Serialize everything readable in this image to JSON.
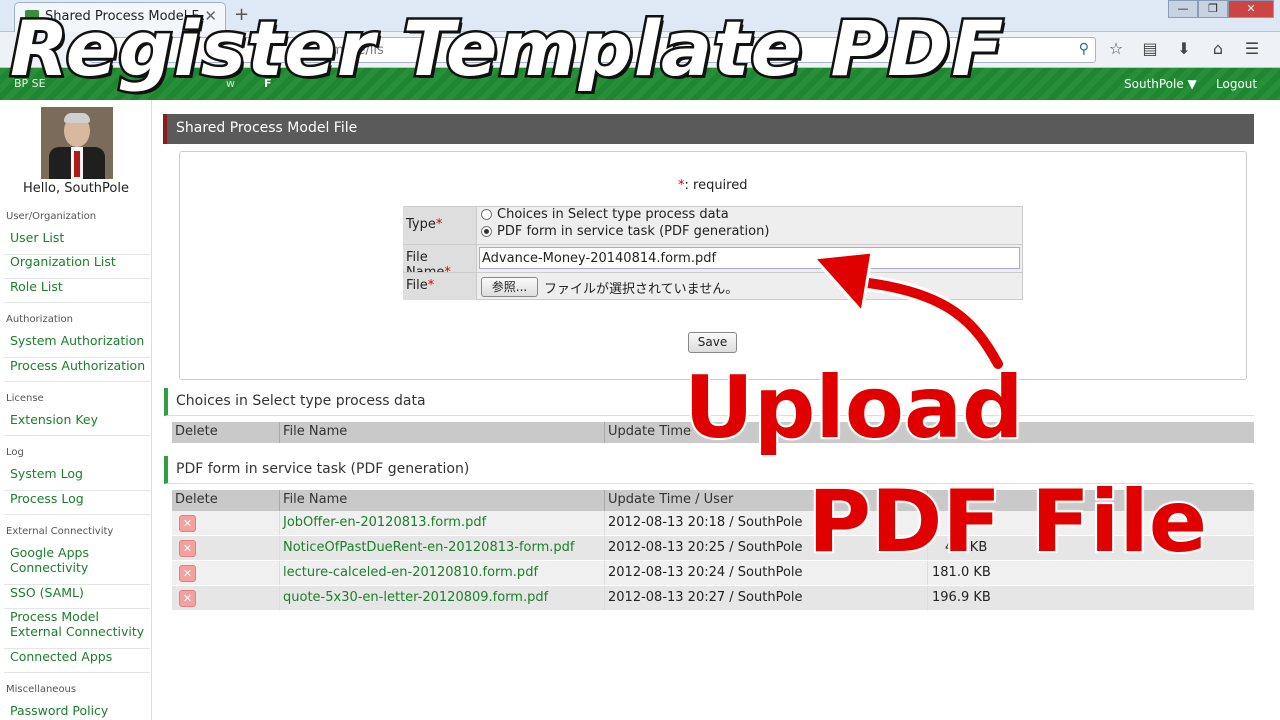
{
  "browser": {
    "tab_title": "Shared Process Model F...",
    "tab_close": "✕",
    "new_tab": "+",
    "url_fragment": "mFile/lis",
    "window_buttons": [
      "—",
      "❐",
      "✕"
    ]
  },
  "overlay": {
    "title": "Register Template PDF",
    "upload_line1": "Upload",
    "upload_line2": "PDF File"
  },
  "header": {
    "logo": "BP SE",
    "menu_partial_1": "w",
    "menu_partial_2": "F",
    "user_menu": "SouthPole ▼",
    "logout": "Logout"
  },
  "sidebar": {
    "greeting": "Hello, SouthPole",
    "sections": [
      {
        "title": "User/Organization",
        "items": [
          "User List",
          "Organization List",
          "Role List"
        ]
      },
      {
        "title": "Authorization",
        "items": [
          "System Authorization",
          "Process Authorization"
        ]
      },
      {
        "title": "License",
        "items": [
          "Extension Key"
        ]
      },
      {
        "title": "Log",
        "items": [
          "System Log",
          "Process Log"
        ]
      },
      {
        "title": "External Connectivity",
        "items": [
          "Google Apps Connectivity",
          "SSO (SAML)",
          "Process Model External Connectivity",
          "Connected Apps"
        ]
      },
      {
        "title": "Miscellaneous",
        "items": [
          "Password Policy"
        ]
      }
    ]
  },
  "main": {
    "panel_title": "Shared Process Model File",
    "required_star": "*",
    "required_text": ": required",
    "form": {
      "type_label": "Type",
      "type_options": [
        "Choices in Select type process data",
        "PDF form in service task (PDF generation)"
      ],
      "type_selected_index": 1,
      "filename_label": "File Name",
      "filename_value": "Advance-Money-20140814.form.pdf",
      "file_label": "File",
      "browse_label": "参照...",
      "no_file_text": "ファイルが選択されていません。",
      "save_label": "Save"
    },
    "section1": {
      "title": "Choices in Select type process data",
      "columns": [
        "Delete",
        "File Name",
        "Update Time"
      ]
    },
    "section2": {
      "title": "PDF form in service task (PDF generation)",
      "columns": [
        "Delete",
        "File Name",
        "Update Time / User"
      ],
      "rows": [
        {
          "name": "JobOffer-en-20120813.form.pdf",
          "updated": "2012-08-13 20:18 / SouthPole",
          "size": "KB"
        },
        {
          "name": "NoticeOfPastDueRent-en-20120813-form.pdf",
          "updated": "2012-08-13 20:25 / SouthPole",
          "size": "4.9 KB"
        },
        {
          "name": "lecture-calceled-en-20120810.form.pdf",
          "updated": "2012-08-13 20:24 / SouthPole",
          "size": "181.0 KB"
        },
        {
          "name": "quote-5x30-en-letter-20120809.form.pdf",
          "updated": "2012-08-13 20:27 / SouthPole",
          "size": "196.9 KB"
        }
      ]
    }
  }
}
